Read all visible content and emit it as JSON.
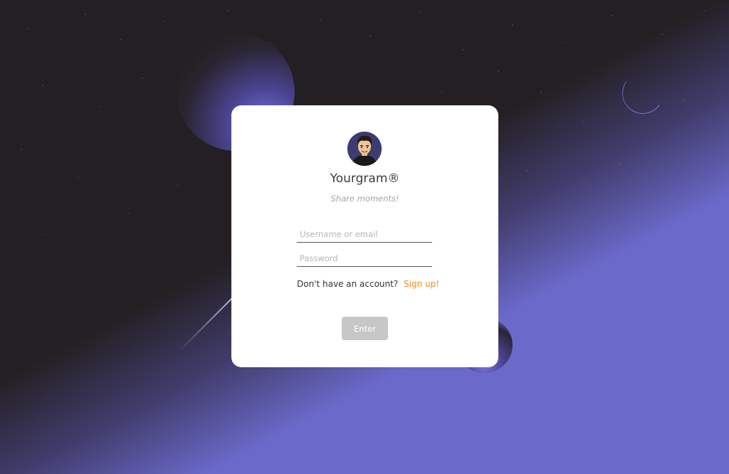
{
  "app": {
    "title": "Yourgram®",
    "tagline": "Share moments!"
  },
  "form": {
    "username_placeholder": "Username or email",
    "username_value": "",
    "password_placeholder": "Password",
    "password_value": "",
    "signup_prompt": "Don't have an account?",
    "signup_link": "Sign up!",
    "submit_label": "Enter"
  },
  "theme": {
    "background": "#231f22",
    "accent_purple": "#6b6acb",
    "link_orange": "#f08a1c",
    "button_disabled": "#c7c7c7",
    "card": "#ffffff"
  },
  "icons": {
    "avatar": "cartoon-man-avatar"
  }
}
